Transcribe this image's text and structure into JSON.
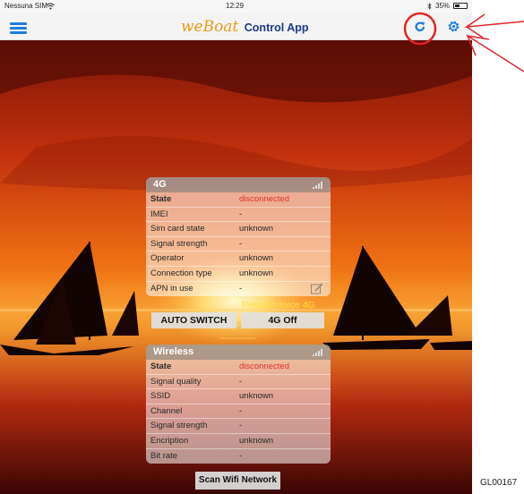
{
  "status_bar": {
    "carrier": "Nessuna SIM",
    "time": "12:29",
    "battery": "35%"
  },
  "nav": {
    "title_brand": "weBoat",
    "title_rest": "Control App"
  },
  "panel_4g": {
    "title": "4G",
    "rows": [
      {
        "label": "State",
        "value": "disconnected"
      },
      {
        "label": "IMEI",
        "value": "-"
      },
      {
        "label": "Sim card state",
        "value": "unknown"
      },
      {
        "label": "Signal strength",
        "value": "-"
      },
      {
        "label": "Operator",
        "value": "unknown"
      },
      {
        "label": "Connection type",
        "value": "unknown"
      },
      {
        "label": "APN in use",
        "value": "-"
      }
    ],
    "force_hint": "Press to force 4G",
    "auto_switch_label": "AUTO SWITCH",
    "off_label": "4G Off"
  },
  "panel_wireless": {
    "title": "Wireless",
    "rows": [
      {
        "label": "State",
        "value": "disconnected"
      },
      {
        "label": "Signal quality",
        "value": "-"
      },
      {
        "label": "SSID",
        "value": "unknown"
      },
      {
        "label": "Channel",
        "value": "-"
      },
      {
        "label": "Signal strength",
        "value": "-"
      },
      {
        "label": "Encription",
        "value": "unknown"
      },
      {
        "label": "Bit rate",
        "value": "-"
      }
    ],
    "scan_label": "Scan Wifi Network"
  },
  "figure_code": "GL00167",
  "colors": {
    "accent_blue": "#1e7fd8",
    "state_red": "#e53030",
    "annotation_red": "#e0252a"
  },
  "icons": [
    "menu-icon",
    "refresh-icon",
    "settings-gear-icon",
    "signal-bars-icon",
    "edit-icon",
    "wifi-icon",
    "battery-icon",
    "bluetooth-icon"
  ]
}
